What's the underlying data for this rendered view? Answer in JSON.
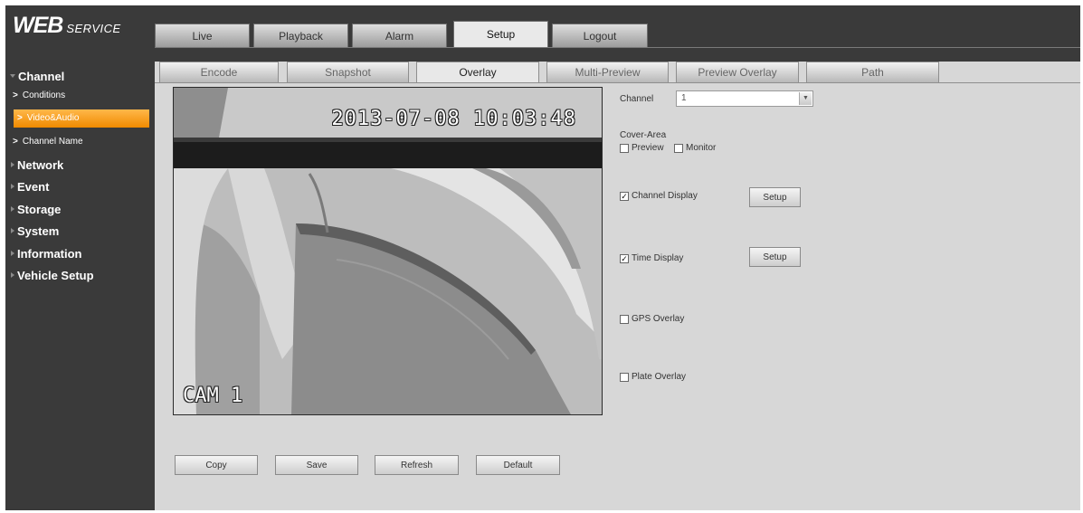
{
  "logo": {
    "main": "WEB",
    "sub": "SERVICE"
  },
  "top_tabs": [
    "Live",
    "Playback",
    "Alarm",
    "Setup",
    "Logout"
  ],
  "active_top_tab": "Setup",
  "sidebar": {
    "channel": {
      "label": "Channel",
      "items": [
        "Conditions",
        "Video&Audio",
        "Channel Name"
      ],
      "selected": "Video&Audio"
    },
    "categories": [
      "Network",
      "Event",
      "Storage",
      "System",
      "Information",
      "Vehicle Setup"
    ]
  },
  "sub_tabs": [
    "Encode",
    "Snapshot",
    "Overlay",
    "Multi-Preview",
    "Preview Overlay",
    "Path"
  ],
  "active_sub_tab": "Overlay",
  "preview": {
    "timestamp": "2013-07-08 10:03:48",
    "camera_label": "CAM 1"
  },
  "overlay": {
    "channel_label": "Channel",
    "channel_value": "1",
    "cover_area_label": "Cover-Area",
    "preview_label": "Preview",
    "preview_checked": false,
    "monitor_label": "Monitor",
    "monitor_checked": false,
    "channel_display_label": "Channel Display",
    "channel_display_checked": true,
    "time_display_label": "Time Display",
    "time_display_checked": true,
    "gps_overlay_label": "GPS Overlay",
    "gps_overlay_checked": false,
    "plate_overlay_label": "Plate Overlay",
    "plate_overlay_checked": false,
    "setup_label": "Setup"
  },
  "buttons": {
    "copy": "Copy",
    "save": "Save",
    "refresh": "Refresh",
    "default": "Default"
  },
  "colors": {
    "sidebar_bg": "#3a3a3a",
    "selected_item": "#f5a623",
    "content_bg": "#d7d7d7"
  }
}
